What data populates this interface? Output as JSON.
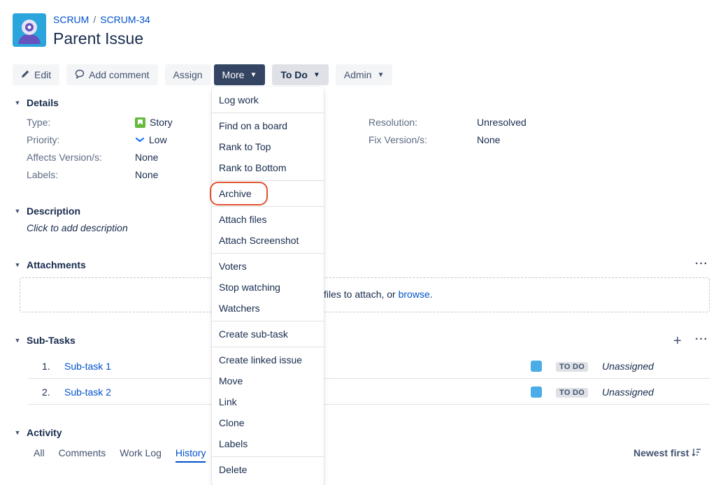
{
  "breadcrumb": {
    "project": "SCRUM",
    "separator": "/",
    "issue_key": "SCRUM-34"
  },
  "title": "Parent Issue",
  "toolbar": {
    "edit": "Edit",
    "add_comment": "Add comment",
    "assign": "Assign",
    "more": "More",
    "status": "To Do",
    "admin": "Admin"
  },
  "details": {
    "heading": "Details",
    "fields": [
      {
        "label": "Type:",
        "value": "Story",
        "icon": "story-icon"
      },
      {
        "label": "Priority:",
        "value": "Low",
        "icon": "priority-low-icon"
      },
      {
        "label": "Affects Version/s:",
        "value": "None"
      },
      {
        "label": "Labels:",
        "value": "None"
      }
    ],
    "right_fields": [
      {
        "label": "Resolution:",
        "value": "Unresolved"
      },
      {
        "label": "Fix Version/s:",
        "value": "None"
      }
    ]
  },
  "description": {
    "heading": "Description",
    "placeholder": "Click to add description"
  },
  "attachments": {
    "heading": "Attachments",
    "drop_text": "files to attach, or",
    "browse": "browse",
    "period": "."
  },
  "subtasks": {
    "heading": "Sub-Tasks",
    "rows": [
      {
        "num": "1.",
        "name": "Sub-task 1",
        "status": "TO DO",
        "assignee": "Unassigned"
      },
      {
        "num": "2.",
        "name": "Sub-task 2",
        "status": "TO DO",
        "assignee": "Unassigned"
      }
    ]
  },
  "activity": {
    "heading": "Activity",
    "tabs": [
      "All",
      "Comments",
      "Work Log",
      "History"
    ],
    "active_tab": "History",
    "sort": "Newest first"
  },
  "more_menu": {
    "groups": [
      [
        "Log work"
      ],
      [
        "Find on a board",
        "Rank to Top",
        "Rank to Bottom"
      ],
      [
        "Archive"
      ],
      [
        "Attach files",
        "Attach Screenshot"
      ],
      [
        "Voters",
        "Stop watching",
        "Watchers"
      ],
      [
        "Create sub-task"
      ],
      [
        "Create linked issue",
        "Move",
        "Link",
        "Clone",
        "Labels"
      ],
      [
        "Delete"
      ]
    ],
    "highlighted_item": "Archive"
  },
  "colors": {
    "link": "#0052cc",
    "more_button": "#344563",
    "highlight": "#e0542f",
    "story": "#63ba3c",
    "subtask": "#4bade8"
  }
}
